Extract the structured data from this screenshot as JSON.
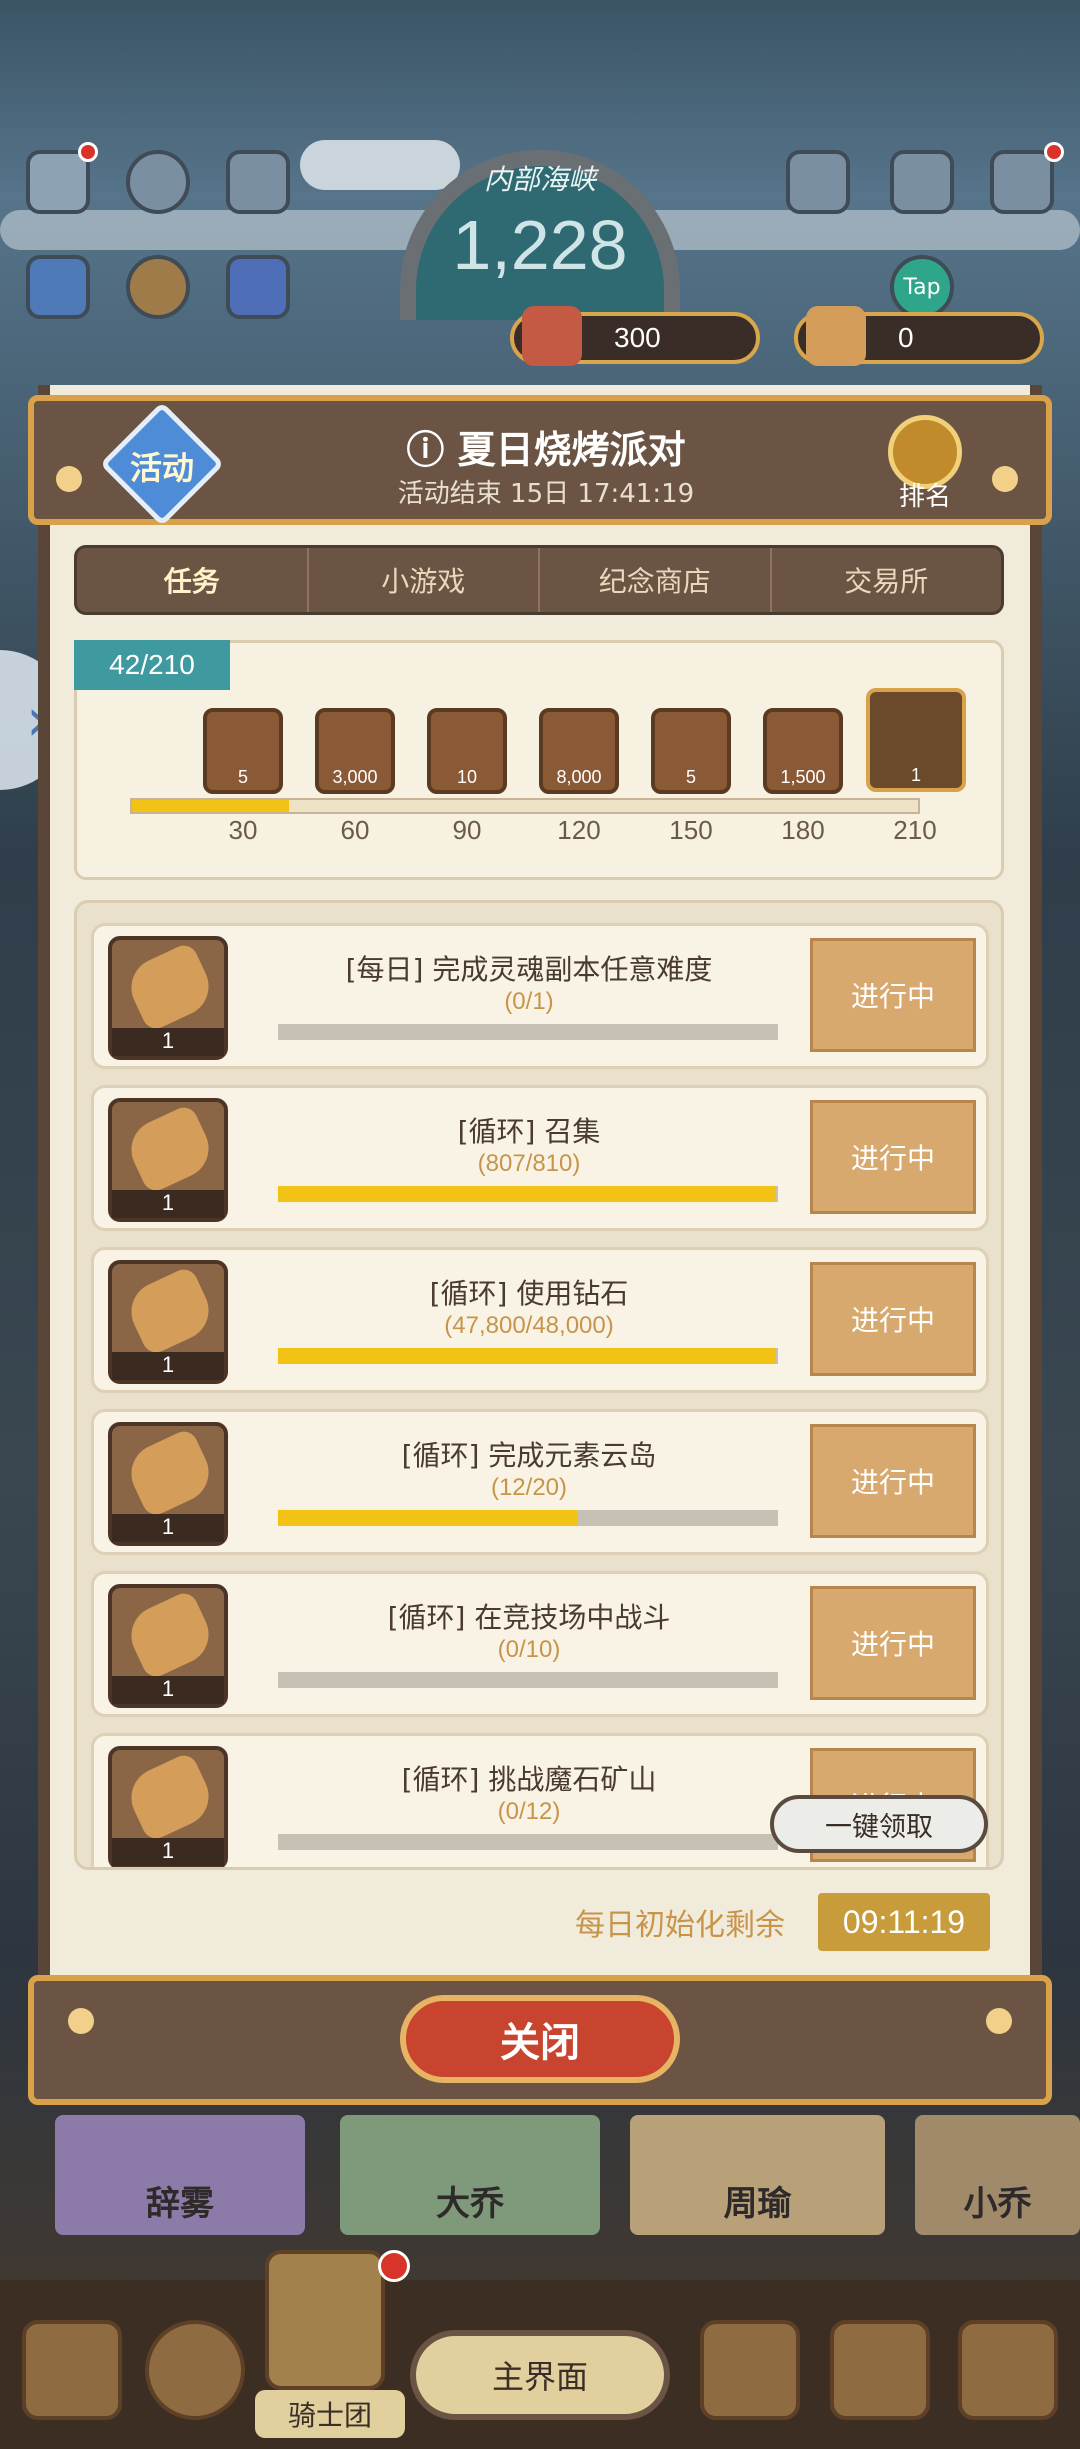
{
  "hud": {
    "zone_name": "内部海峡",
    "zone_score": "1,228",
    "tap_label": "Tap",
    "meat_count": "300",
    "log_count": "0"
  },
  "event": {
    "badge": "活动",
    "title": "夏日烧烤派对",
    "subtitle": "活动结束 15日 17:41:19",
    "rank_label": "排名"
  },
  "tabs": [
    {
      "label": "任务"
    },
    {
      "label": "小游戏"
    },
    {
      "label": "纪念商店"
    },
    {
      "label": "交易所"
    }
  ],
  "progress": {
    "label": "42/210",
    "value": 42,
    "max": 210,
    "milestones": [
      {
        "at": "30",
        "reward_icon": "gold-bars-icon",
        "count": "5"
      },
      {
        "at": "60",
        "reward_icon": "gold-pile-icon",
        "count": "3,000"
      },
      {
        "at": "90",
        "reward_icon": "log-icon",
        "count": "10"
      },
      {
        "at": "120",
        "reward_icon": "meat-icon",
        "count": "8,000"
      },
      {
        "at": "150",
        "reward_icon": "pickaxe-icon",
        "count": "5"
      },
      {
        "at": "180",
        "reward_icon": "diamond-icon",
        "count": "1,500"
      },
      {
        "at": "210",
        "reward_icon": "three-star-chest-icon",
        "count": "1"
      }
    ]
  },
  "quests": [
    {
      "title": "[每日] 完成灵魂副本任意难度",
      "count": "(0/1)",
      "fraction": 0.0,
      "reward": "1",
      "button": "进行中"
    },
    {
      "title": "[循环] 召集",
      "count": "(807/810)",
      "fraction": 0.996,
      "reward": "1",
      "button": "进行中"
    },
    {
      "title": "[循环] 使用钻石",
      "count": "(47,800/48,000)",
      "fraction": 0.996,
      "reward": "1",
      "button": "进行中"
    },
    {
      "title": "[循环] 完成元素云岛",
      "count": "(12/20)",
      "fraction": 0.6,
      "reward": "1",
      "button": "进行中"
    },
    {
      "title": "[循环] 在竞技场中战斗",
      "count": "(0/10)",
      "fraction": 0.0,
      "reward": "1",
      "button": "进行中"
    },
    {
      "title": "[循环] 挑战魔石矿山",
      "count": "(0/12)",
      "fraction": 0.0,
      "reward": "1",
      "button": "进行中"
    }
  ],
  "claim_all": "一键领取",
  "reset": {
    "label": "每日初始化剩余",
    "time": "09:11:19"
  },
  "close": "关闭",
  "heroes": [
    {
      "name": "辞雾"
    },
    {
      "name": "大乔"
    },
    {
      "name": "周瑜"
    },
    {
      "name": "小乔"
    }
  ],
  "bottom_nav": {
    "knight_label": "骑士团",
    "main_label": "主界面"
  },
  "colors": {
    "panel": "#f1ebdb",
    "header": "#6b5444",
    "gold_border": "#d9a24a",
    "progress_fill": "#f2c315",
    "button": "#d8a96f",
    "close": "#c9442f"
  }
}
